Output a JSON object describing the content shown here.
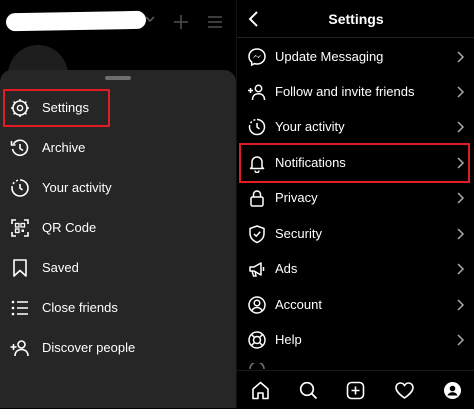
{
  "menu": {
    "items": [
      {
        "label": "Settings",
        "icon": "settings-icon"
      },
      {
        "label": "Archive",
        "icon": "archive-icon"
      },
      {
        "label": "Your activity",
        "icon": "activity-icon"
      },
      {
        "label": "QR Code",
        "icon": "qr-code-icon"
      },
      {
        "label": "Saved",
        "icon": "saved-icon"
      },
      {
        "label": "Close friends",
        "icon": "close-friends-icon"
      },
      {
        "label": "Discover people",
        "icon": "discover-people-icon"
      }
    ]
  },
  "settings": {
    "title": "Settings",
    "items": [
      {
        "label": "Update Messaging",
        "icon": "messenger-icon"
      },
      {
        "label": "Follow and invite friends",
        "icon": "add-person-icon"
      },
      {
        "label": "Your activity",
        "icon": "activity-icon"
      },
      {
        "label": "Notifications",
        "icon": "bell-icon"
      },
      {
        "label": "Privacy",
        "icon": "lock-icon"
      },
      {
        "label": "Security",
        "icon": "shield-icon"
      },
      {
        "label": "Ads",
        "icon": "megaphone-icon"
      },
      {
        "label": "Account",
        "icon": "account-icon"
      },
      {
        "label": "Help",
        "icon": "lifebuoy-icon"
      }
    ]
  },
  "bottom_nav": [
    "home-icon",
    "search-icon",
    "new-post-icon",
    "heart-icon",
    "profile-icon"
  ],
  "colors": {
    "highlight": "#e31b23",
    "sheet": "#262626",
    "background": "#000000"
  }
}
